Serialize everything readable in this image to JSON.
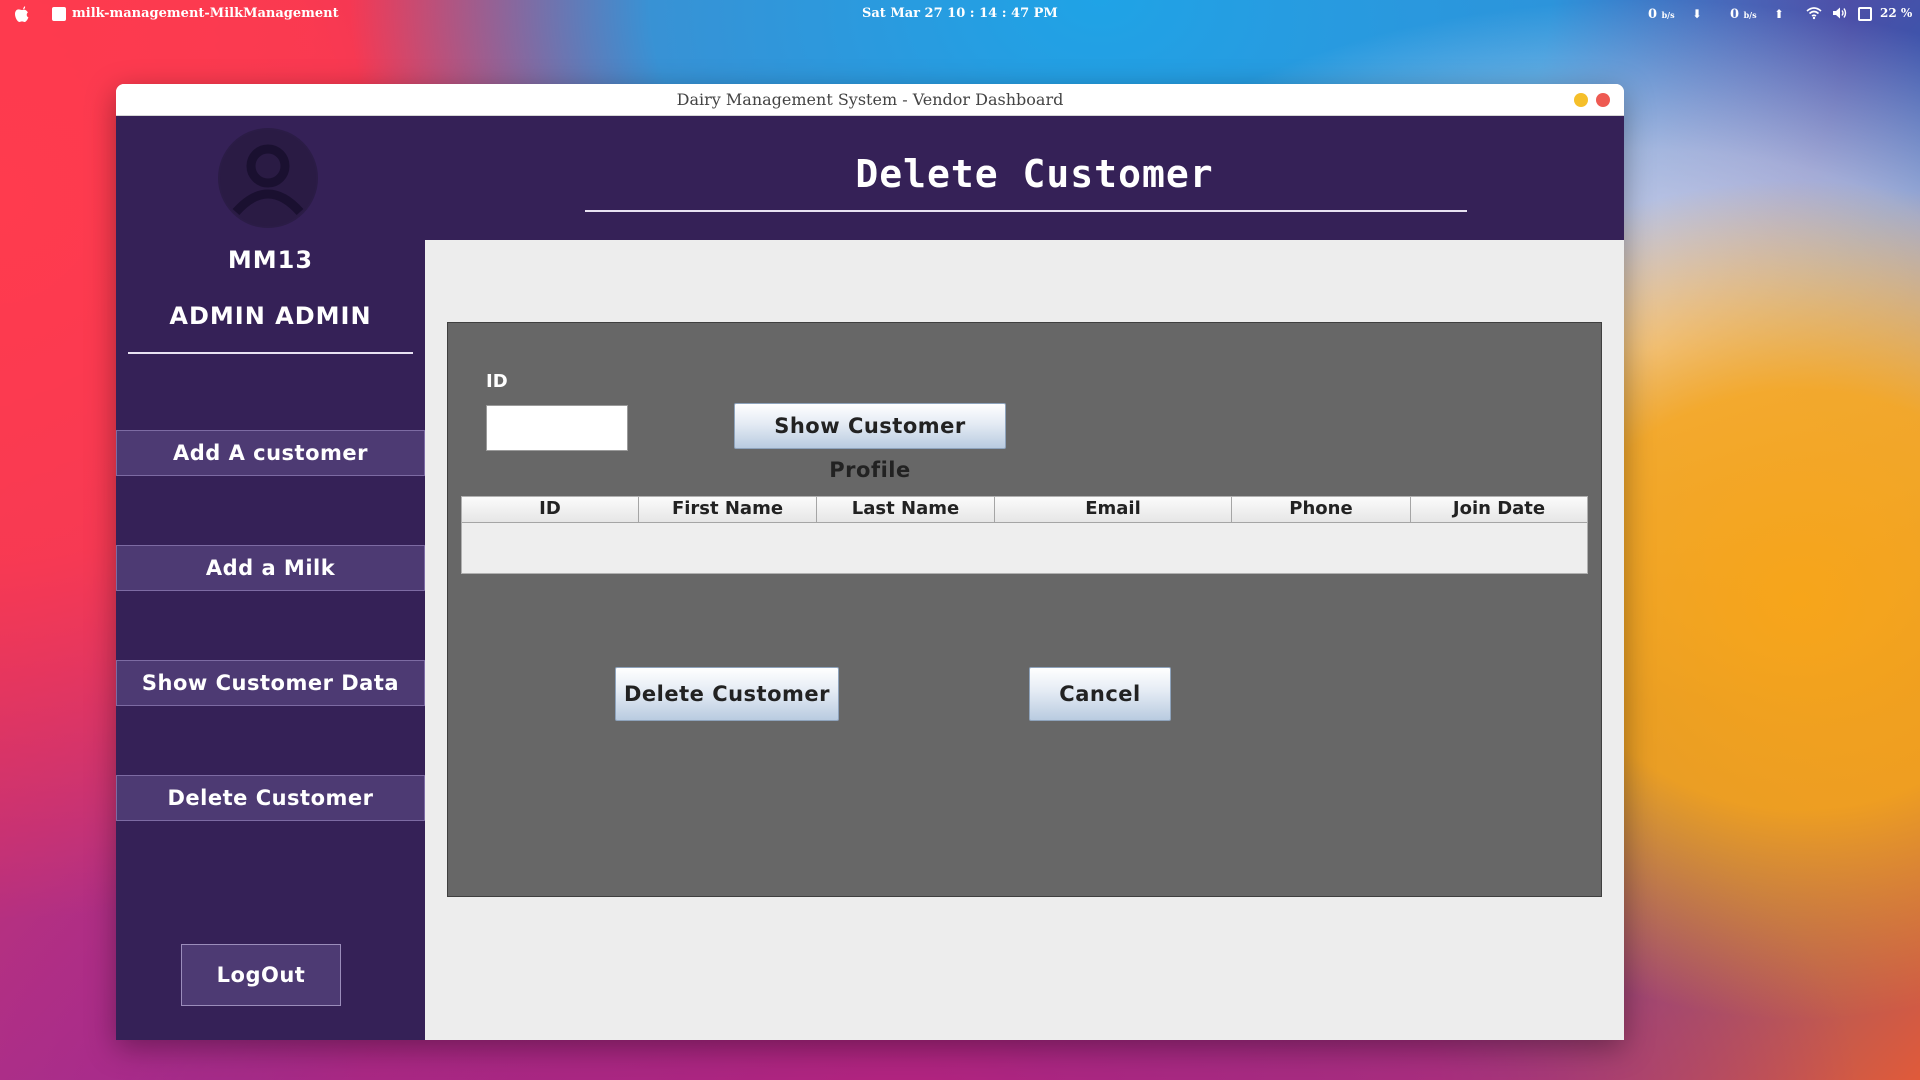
{
  "menubar": {
    "app_name": "milk-management-MilkManagement",
    "clock": "Sat Mar 27  10 : 14 : 47 PM",
    "net_down_value": "0",
    "net_down_unit": "b/s",
    "net_up_value": "0",
    "net_up_unit": "b/s",
    "battery": "22 %"
  },
  "window": {
    "title": "Dairy Management System - Vendor Dashboard"
  },
  "sidebar": {
    "user_code": "MM13",
    "user_name": "ADMIN ADMIN",
    "items": [
      {
        "label": "Add A customer"
      },
      {
        "label": "Add a Milk"
      },
      {
        "label": "Show Customer Data"
      },
      {
        "label": "Delete Customer"
      }
    ],
    "logout_label": "LogOut"
  },
  "header": {
    "title": "Delete Customer"
  },
  "form": {
    "id_label": "ID",
    "id_value": "",
    "show_profile_label": "Show Customer Profile",
    "delete_label": "Delete Customer",
    "cancel_label": "Cancel"
  },
  "table": {
    "columns": [
      "ID",
      "First Name",
      "Last Name",
      "Email",
      "Phone",
      "Join Date"
    ],
    "rows": []
  },
  "colors": {
    "sidebar_bg": "#352157",
    "nav_button_bg": "#4d3a73",
    "panel_bg": "#676767",
    "content_bg": "#ededed"
  },
  "icons": {
    "apple": "apple-icon",
    "avatar": "user-avatar-icon",
    "wifi": "wifi-icon",
    "volume": "volume-icon",
    "battery": "battery-icon"
  }
}
